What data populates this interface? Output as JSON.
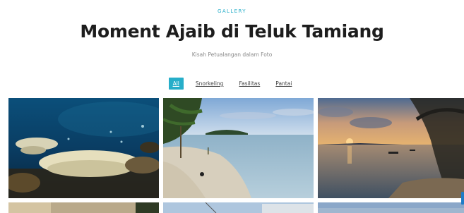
{
  "header": {
    "eyebrow": "GALLERY",
    "title": "Moment Ajaib di Teluk Tamiang",
    "subtitle": "Kisah Petualangan dalam Foto"
  },
  "filters": [
    {
      "label": "All",
      "active": true
    },
    {
      "label": "Snorkeling",
      "active": false
    },
    {
      "label": "Fasilitas",
      "active": false
    },
    {
      "label": "Pantai",
      "active": false
    }
  ],
  "colors": {
    "accent": "#27aec9",
    "title": "#1d1d1d",
    "subtitle": "#8a8a8a"
  },
  "gallery": {
    "photos": [
      {
        "subject": "coral reef underwater"
      },
      {
        "subject": "sandy beach with palm trees"
      },
      {
        "subject": "sunset over bay with boats"
      },
      {
        "subject": "beach photo (partially visible)"
      },
      {
        "subject": "facility photo (partially visible)"
      },
      {
        "subject": "beach photo (partially visible)"
      }
    ]
  }
}
